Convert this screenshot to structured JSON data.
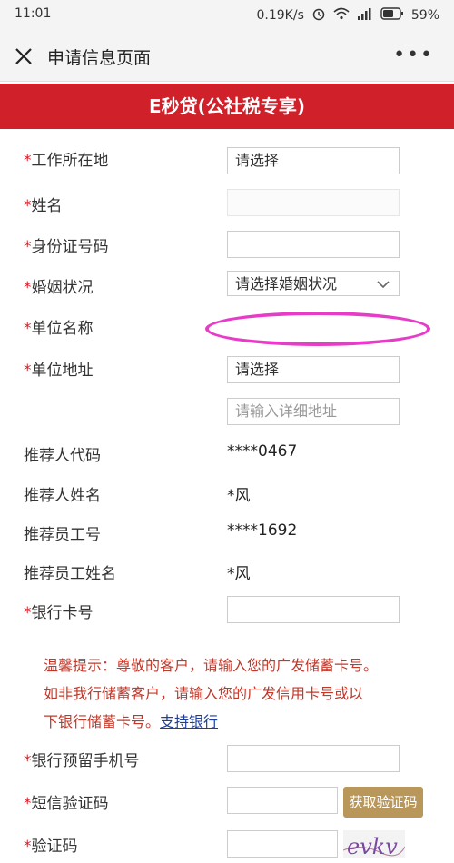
{
  "status": {
    "time": "11:01",
    "speed": "0.19K/s",
    "battery": "59%",
    "icons": [
      "alarm-icon",
      "wifi-icon",
      "signal-icon",
      "battery-icon"
    ]
  },
  "nav": {
    "title": "申请信息页面",
    "close_icon": "close-icon",
    "more_icon": "more-icon"
  },
  "banner": {
    "title": "E秒贷(公社税专享)"
  },
  "form": {
    "work_location": {
      "label": "工作所在地",
      "value": "请选择"
    },
    "name": {
      "label": "姓名",
      "value": ""
    },
    "id_number": {
      "label": "身份证号码",
      "value": ""
    },
    "marital": {
      "label": "婚姻状况",
      "value": "请选择婚姻状况"
    },
    "company_name": {
      "label": "单位名称",
      "value": ""
    },
    "company_address": {
      "label": "单位地址",
      "value": "请选择",
      "detail_placeholder": "请输入详细地址"
    },
    "referrer_code": {
      "label": "推荐人代码",
      "value": "****0467"
    },
    "referrer_name": {
      "label": "推荐人姓名",
      "value": "*风"
    },
    "staff_id": {
      "label": "推荐员工号",
      "value": "****1692"
    },
    "staff_name": {
      "label": "推荐员工姓名",
      "value": "*风"
    },
    "bank_card": {
      "label": "银行卡号",
      "value": ""
    },
    "notice": {
      "line1": "温馨提示：尊敬的客户，请输入您的广发储蓄卡号。",
      "line2": "如非我行储蓄客户，请输入您的广发信用卡号或以",
      "line3": "下银行储蓄卡号。",
      "link": "支持银行"
    },
    "phone": {
      "label": "银行预留手机号",
      "value": ""
    },
    "sms_code": {
      "label": "短信验证码",
      "value": "",
      "button": "获取验证码"
    },
    "captcha": {
      "label": "验证码",
      "value": "",
      "image_text": "evkv"
    },
    "required_mark": "*"
  }
}
